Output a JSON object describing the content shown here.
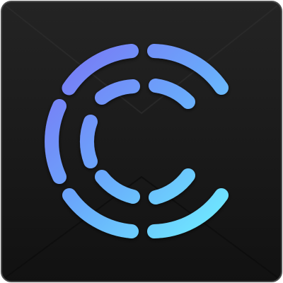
{
  "icon": {
    "name": "app-logo-icon",
    "shape": "segmented-c-arcs",
    "colors": {
      "background": "#1a1a1a",
      "background_edge": "#3a3a3a",
      "gradient_start": "#7b7cf6",
      "gradient_end": "#6ff0ff"
    }
  }
}
